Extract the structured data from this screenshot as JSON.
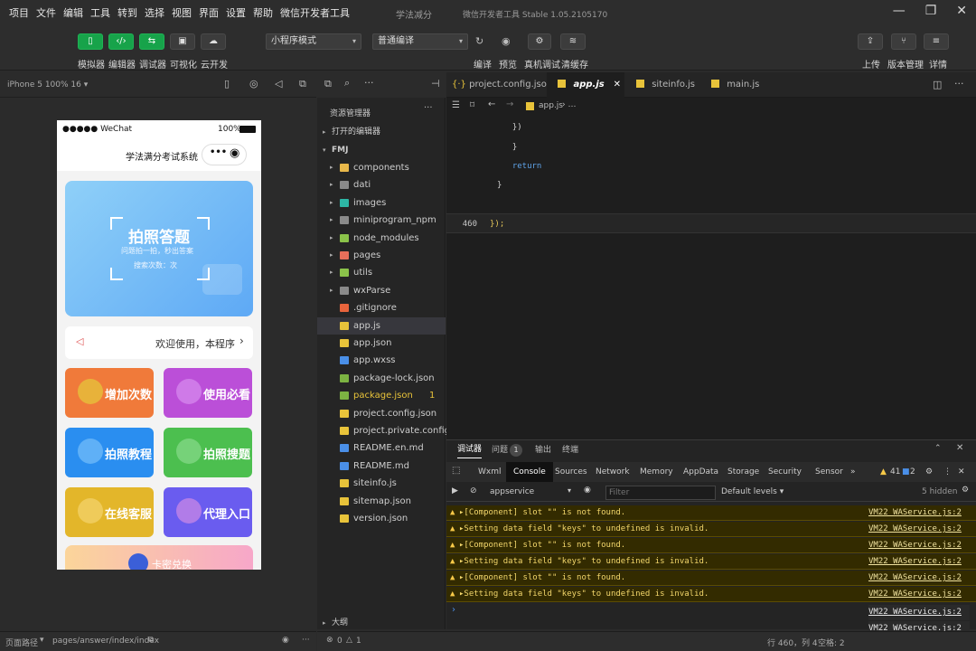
{
  "menubar": {
    "items": [
      "项目",
      "文件",
      "编辑",
      "工具",
      "转到",
      "选择",
      "视图",
      "界面",
      "设置",
      "帮助",
      "微信开发者工具"
    ],
    "window_title": "学法减分",
    "app_version": "微信开发者工具 Stable 1.05.2105170"
  },
  "toolbar": {
    "left_buttons": [
      {
        "label": "模拟器",
        "icon": "phone-icon"
      },
      {
        "label": "编辑器",
        "icon": "code-icon"
      },
      {
        "label": "调试器",
        "icon": "debug-icon"
      },
      {
        "label": "可视化",
        "icon": "layout-icon"
      },
      {
        "label": "云开发",
        "icon": "cloud-icon"
      }
    ],
    "mode_select": "小程序模式",
    "compile_select": "普通编译",
    "center_buttons": [
      "编译",
      "预览",
      "真机调试",
      "清缓存"
    ],
    "right_buttons": [
      "上传",
      "版本管理",
      "详情"
    ]
  },
  "simulator": {
    "device": "iPhone 5 100% 16 ▾",
    "status_carrier": "●●●●● WeChat",
    "status_battery": "100%",
    "nav_title": "学法满分考试系统",
    "capsule_dots": "•••",
    "banner_title": "拍照答题",
    "banner_sub1": "问题拍一拍，秒出答案",
    "banner_sub2": "搜索次数：次",
    "notice_text": "欢迎使用，本程序",
    "cards": [
      {
        "label": "增加次数",
        "color": "#f07a3a"
      },
      {
        "label": "使用必看",
        "color": "#bb4fd8"
      },
      {
        "label": "拍照教程",
        "color": "#2a8ef0"
      },
      {
        "label": "拍照搜题",
        "color": "#4cbf4f"
      },
      {
        "label": "在线客服",
        "color": "#e3b62a"
      },
      {
        "label": "代理入口",
        "color": "#6a5cef"
      }
    ],
    "bottom_card": "卡密兑换"
  },
  "explorer": {
    "title": "资源管理器",
    "open_editors": "打开的编辑器",
    "project": "FMJ",
    "items": [
      {
        "name": "components",
        "kind": "folder",
        "color": "#e8b84a"
      },
      {
        "name": "dati",
        "kind": "folder",
        "color": "#8a8a8a"
      },
      {
        "name": "images",
        "kind": "folder",
        "color": "#2db7a6"
      },
      {
        "name": "miniprogram_npm",
        "kind": "folder",
        "color": "#8a8a8a"
      },
      {
        "name": "node_modules",
        "kind": "folder",
        "color": "#8bc34a"
      },
      {
        "name": "pages",
        "kind": "folder",
        "color": "#e86f5a"
      },
      {
        "name": "utils",
        "kind": "folder",
        "color": "#8bc34a"
      },
      {
        "name": "wxParse",
        "kind": "folder",
        "color": "#8a8a8a"
      },
      {
        "name": ".gitignore",
        "kind": "file",
        "color": "#e8643c"
      },
      {
        "name": "app.js",
        "kind": "file",
        "color": "#e8c33a"
      },
      {
        "name": "app.json",
        "kind": "file",
        "color": "#e8c33a"
      },
      {
        "name": "app.wxss",
        "kind": "file",
        "color": "#4a8fe8"
      },
      {
        "name": "package-lock.json",
        "kind": "file",
        "color": "#7cb342"
      },
      {
        "name": "package.json",
        "kind": "file",
        "color": "#7cb342",
        "badge": "1"
      },
      {
        "name": "project.config.json",
        "kind": "file",
        "color": "#e8c33a"
      },
      {
        "name": "project.private.config.js...",
        "kind": "file",
        "color": "#e8c33a"
      },
      {
        "name": "README.en.md",
        "kind": "file",
        "color": "#4a8fe8"
      },
      {
        "name": "README.md",
        "kind": "file",
        "color": "#4a8fe8"
      },
      {
        "name": "siteinfo.js",
        "kind": "file",
        "color": "#e8c33a"
      },
      {
        "name": "sitemap.json",
        "kind": "file",
        "color": "#e8c33a"
      },
      {
        "name": "version.json",
        "kind": "file",
        "color": "#e8c33a"
      }
    ],
    "outline": "大纲"
  },
  "editor": {
    "tabs": [
      {
        "label": "project.config.json",
        "active": false
      },
      {
        "label": "app.js",
        "active": true
      },
      {
        "label": "siteinfo.js",
        "active": false
      },
      {
        "label": "main.js",
        "active": false
      }
    ],
    "breadcrumb": "app.js",
    "lines": [
      {
        "no": "",
        "text": "  })"
      },
      {
        "no": "",
        "text": "  }"
      },
      {
        "no": "",
        "text": "  return"
      },
      {
        "no": "",
        "text": "}"
      },
      {
        "no": "",
        "text": ""
      },
      {
        "no": "460",
        "text": "});"
      }
    ]
  },
  "devtools": {
    "top_tabs": [
      "调试器",
      "问题",
      "输出",
      "终端"
    ],
    "problems_count": "1",
    "panel_tabs": [
      "Wxml",
      "Console",
      "Sources",
      "Network",
      "Memory",
      "AppData",
      "Storage",
      "Security",
      "Sensor"
    ],
    "warn_count": "41",
    "info_count": "2",
    "context": "appservice",
    "filter_placeholder": "Filter",
    "levels": "Default levels ▾",
    "hidden": "5 hidden",
    "logs": [
      {
        "msg": "▸[Component] slot \"\" is not found.",
        "src": "VM22 WAService.js:2"
      },
      {
        "msg": "▸Setting data field \"keys\" to undefined is invalid.",
        "src": "VM22 WAService.js:2"
      },
      {
        "msg": "▸[Component] slot \"\" is not found.",
        "src": "VM22 WAService.js:2"
      },
      {
        "msg": "▸Setting data field \"keys\" to undefined is invalid.",
        "src": "VM22 WAService.js:2"
      },
      {
        "msg": "▸[Component] slot \"\" is not found.",
        "src": "VM22 WAService.js:2"
      },
      {
        "msg": "▸Setting data field \"keys\" to undefined is invalid.",
        "src": "VM22 WAService.js:2"
      }
    ],
    "overflow_src": [
      "VM22 WAService.js:2",
      "VM22 WAService.js:2",
      "VM22 WAService.js:2"
    ],
    "prompt": "›"
  },
  "statusbar": {
    "path_label": "页面路径",
    "path": "pages/answer/index/index",
    "errors": "0",
    "warnings": "1",
    "cursor": "行 460，列 4",
    "indent": "空格: 2"
  }
}
